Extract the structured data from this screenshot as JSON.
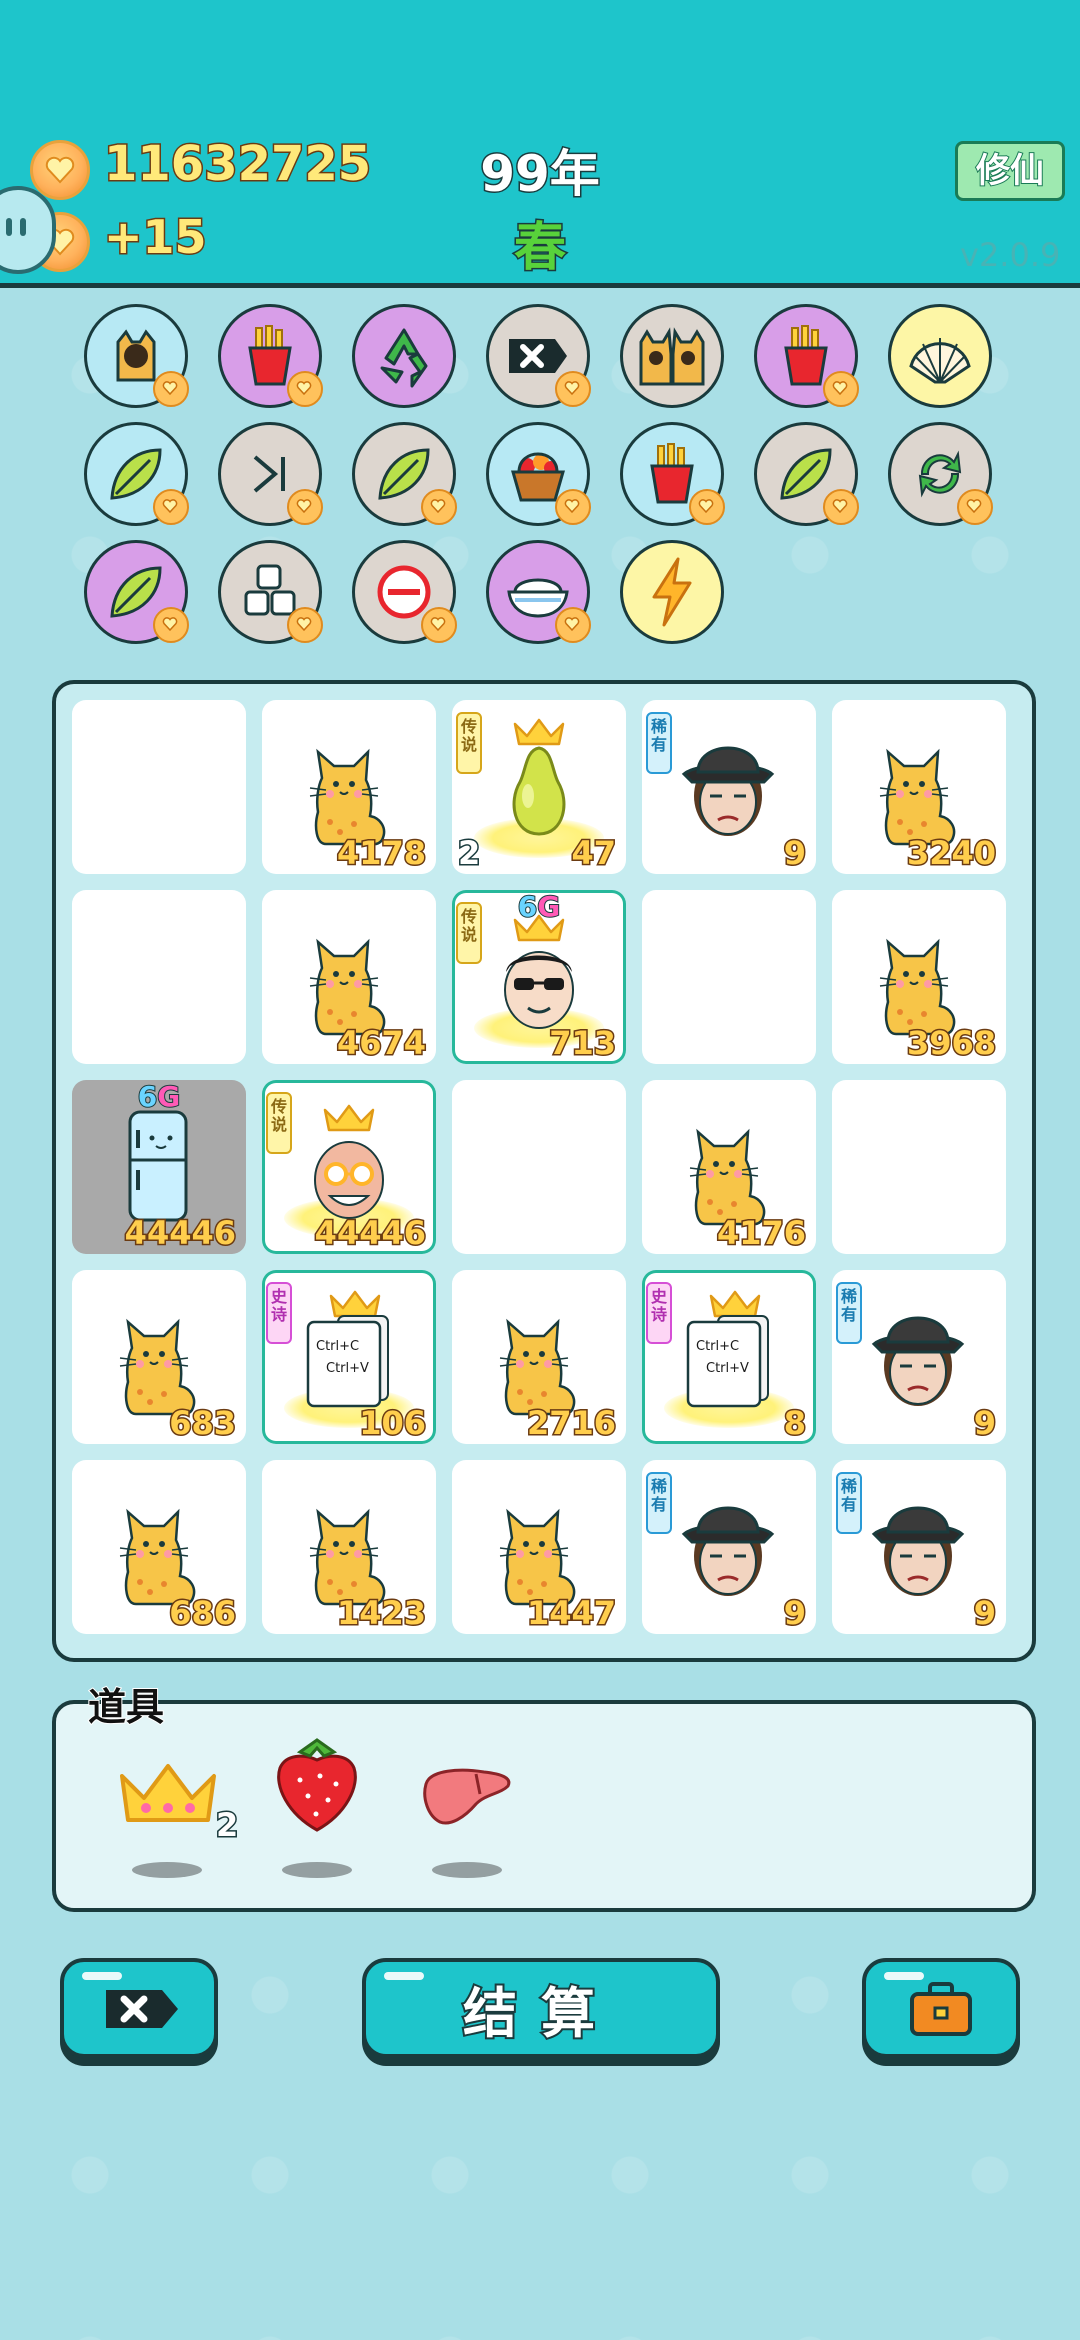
{
  "header": {
    "coins": "11632725",
    "coins_per_turn": "+15",
    "year": "99年",
    "season": "春",
    "xiuxian_button": "修仙",
    "version": "v2.0.9"
  },
  "skills": [
    {
      "icon": "cat-frame-icon",
      "bg": "blue",
      "heart": true
    },
    {
      "icon": "fries-icon",
      "bg": "purple",
      "heart": true
    },
    {
      "icon": "recycle-icon",
      "bg": "purple",
      "heart": false
    },
    {
      "icon": "delete-tag-icon",
      "bg": "grey",
      "heart": true
    },
    {
      "icon": "cat-pair-icon",
      "bg": "grey",
      "heart": false
    },
    {
      "icon": "fries-icon",
      "bg": "purple",
      "heart": true
    },
    {
      "icon": "shell-icon",
      "bg": "yellow",
      "heart": false
    },
    {
      "icon": "leaf-icon",
      "bg": "blue",
      "heart": true
    },
    {
      "icon": "skip-icon",
      "bg": "grey",
      "heart": true
    },
    {
      "icon": "leaf-icon",
      "bg": "grey",
      "heart": true
    },
    {
      "icon": "fruit-basket-icon",
      "bg": "blue",
      "heart": true
    },
    {
      "icon": "fries-icon",
      "bg": "blue",
      "heart": true
    },
    {
      "icon": "leaf-icon",
      "bg": "grey",
      "heart": true
    },
    {
      "icon": "refresh-icon",
      "bg": "grey",
      "heart": true
    },
    {
      "icon": "leaf-icon",
      "bg": "purple",
      "heart": true
    },
    {
      "icon": "cubes-icon",
      "bg": "grey",
      "heart": true
    },
    {
      "icon": "minus-icon",
      "bg": "grey",
      "heart": true
    },
    {
      "icon": "rice-bowl-icon",
      "bg": "purple",
      "heart": true
    },
    {
      "icon": "lightning-icon",
      "bg": "yellow",
      "heart": false
    }
  ],
  "board": [
    [
      {
        "type": "empty"
      },
      {
        "type": "cat",
        "value": "4178"
      },
      {
        "type": "pear",
        "tag": "传说",
        "value": "47",
        "left": "2"
      },
      {
        "type": "hat-man",
        "tag": "稀有",
        "value": "9"
      },
      {
        "type": "cat",
        "value": "3240"
      }
    ],
    [
      {
        "type": "empty"
      },
      {
        "type": "cat",
        "value": "4674"
      },
      {
        "type": "sunglasses-man",
        "tag": "传说",
        "value": "713",
        "sixg": true,
        "teal": true
      },
      {
        "type": "empty"
      },
      {
        "type": "cat",
        "value": "3968"
      }
    ],
    [
      {
        "type": "fridge",
        "value": "44446",
        "sixg": true,
        "grey": true
      },
      {
        "type": "grandpa",
        "tag": "传说",
        "value": "44446",
        "teal": true
      },
      {
        "type": "empty"
      },
      {
        "type": "cat",
        "value": "4176"
      },
      {
        "type": "empty"
      }
    ],
    [
      {
        "type": "cat",
        "value": "683"
      },
      {
        "type": "ctrlcv",
        "tag": "史诗",
        "value": "106",
        "teal": true
      },
      {
        "type": "cat",
        "value": "2716"
      },
      {
        "type": "ctrlcv",
        "tag": "史诗",
        "value": "8",
        "teal": true
      },
      {
        "type": "hat-man",
        "tag": "稀有",
        "value": "9"
      }
    ],
    [
      {
        "type": "cat",
        "value": "686"
      },
      {
        "type": "cat",
        "value": "1423"
      },
      {
        "type": "cat",
        "value": "1447"
      },
      {
        "type": "hat-man",
        "tag": "稀有",
        "value": "9"
      },
      {
        "type": "hat-man",
        "tag": "稀有",
        "value": "9"
      }
    ]
  ],
  "sixg_label": {
    "six": "6",
    "g": "G"
  },
  "ctrl_copy": "Ctrl+C",
  "ctrl_paste": "Ctrl+V",
  "props": {
    "label": "道具",
    "items": [
      {
        "icon": "crown-icon",
        "count": "2"
      },
      {
        "icon": "strawberry-icon",
        "count": ""
      },
      {
        "icon": "liver-icon",
        "count": ""
      }
    ]
  },
  "bottom": {
    "settle_label": "结算"
  },
  "colors": {
    "header_bg": "#1ec5cb",
    "page_bg": "#a9dfe6",
    "coin": "#ffb25c",
    "value_text": "#ffce4d"
  }
}
